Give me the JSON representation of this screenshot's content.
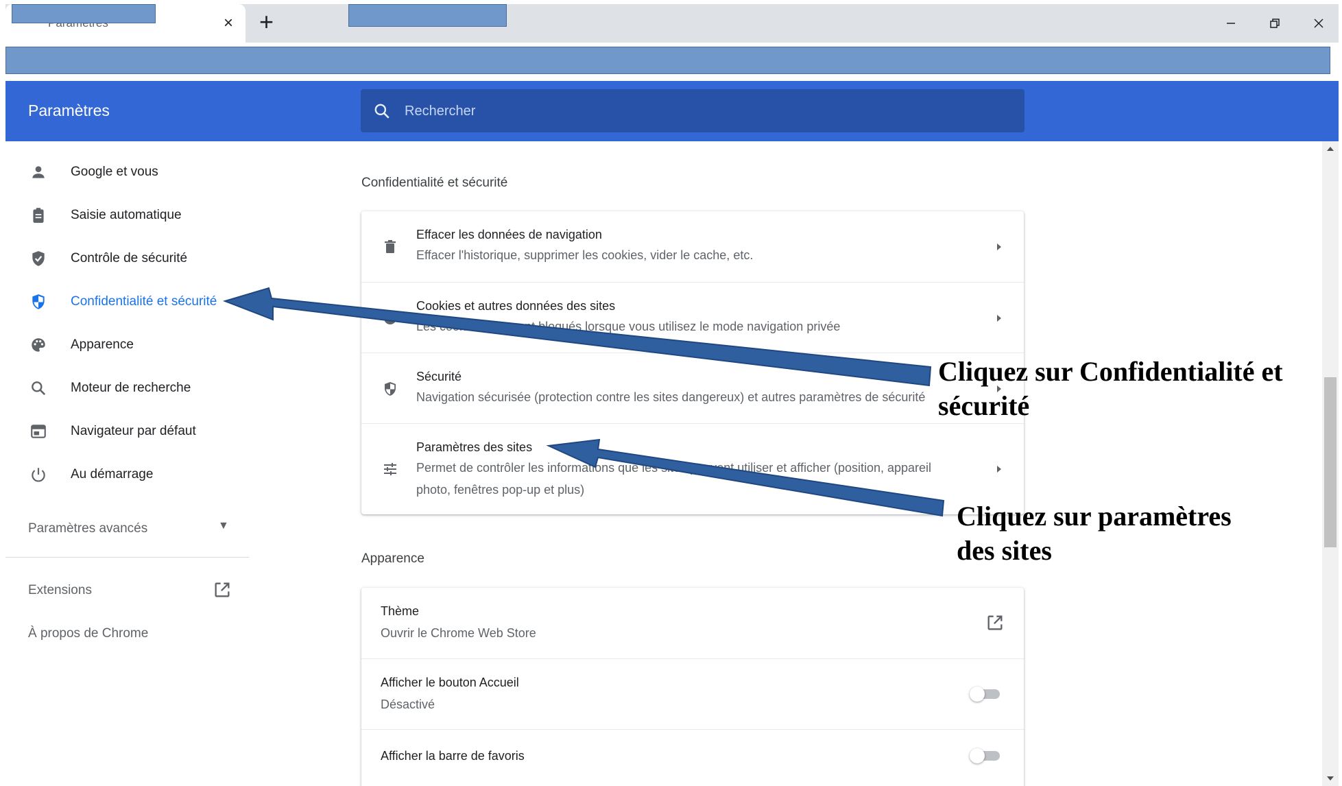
{
  "browser": {
    "tab_title": "Paramètres",
    "tab_close": "×",
    "new_tab": "+"
  },
  "header": {
    "title": "Paramètres",
    "search_placeholder": "Rechercher"
  },
  "sidebar": {
    "items": [
      {
        "label": "Google et vous",
        "icon": "person-icon"
      },
      {
        "label": "Saisie automatique",
        "icon": "clipboard-icon"
      },
      {
        "label": "Contrôle de sécurité",
        "icon": "shield-check-icon"
      },
      {
        "label": "Confidentialité et sécurité",
        "icon": "shield-icon",
        "active": true
      },
      {
        "label": "Apparence",
        "icon": "palette-icon"
      },
      {
        "label": "Moteur de recherche",
        "icon": "search-icon"
      },
      {
        "label": "Navigateur par défaut",
        "icon": "browser-icon"
      },
      {
        "label": "Au démarrage",
        "icon": "power-icon"
      }
    ],
    "advanced_label": "Paramètres avancés",
    "extensions_label": "Extensions",
    "about_label": "À propos de Chrome"
  },
  "privacy": {
    "section_title": "Confidentialité et sécurité",
    "rows": [
      {
        "title": "Effacer les données de navigation",
        "subtitle": "Effacer l'historique, supprimer les cookies, vider le cache, etc.",
        "icon": "trash-icon"
      },
      {
        "title": "Cookies et autres données des sites",
        "subtitle": "Les cookies tiers sont bloqués lorsque vous utilisez le mode navigation privée",
        "icon": "cookie-icon"
      },
      {
        "title": "Sécurité",
        "subtitle": "Navigation sécurisée (protection contre les sites dangereux) et autres paramètres de sécurité",
        "icon": "shield-icon"
      },
      {
        "title": "Paramètres des sites",
        "subtitle": "Permet de contrôler les informations que les sites peuvent utiliser et afficher (position, appareil photo, fenêtres pop-up et plus)",
        "icon": "tune-icon"
      }
    ]
  },
  "appearance": {
    "section_title": "Apparence",
    "theme_title": "Thème",
    "theme_subtitle": "Ouvrir le Chrome Web Store",
    "home_title": "Afficher le bouton Accueil",
    "home_subtitle": "Désactivé",
    "bookmarks_title": "Afficher la barre de favoris"
  },
  "annotations": {
    "callout_1_line1": "Cliquez sur Confidentialité et",
    "callout_1_line2": "sécurité",
    "callout_2_line1": "Cliquez sur paramètres",
    "callout_2_line2": "des sites",
    "arrow_color": "#2f5f9f"
  },
  "colors": {
    "accent": "#3367d6",
    "search_bg": "#2752a8",
    "active_text": "#1a73e8",
    "redaction": "#7198cb"
  }
}
